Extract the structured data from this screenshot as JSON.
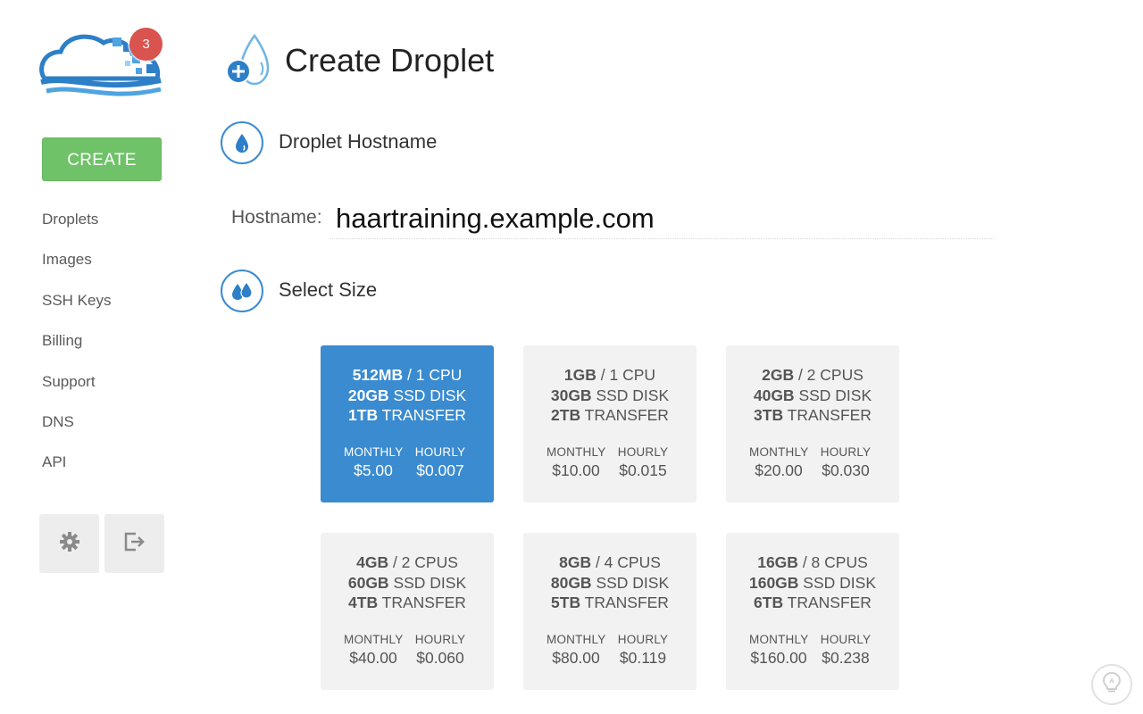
{
  "sidebar": {
    "notification_count": "3",
    "create_label": "CREATE",
    "items": [
      {
        "label": "Droplets"
      },
      {
        "label": "Images"
      },
      {
        "label": "SSH Keys"
      },
      {
        "label": "Billing"
      },
      {
        "label": "Support"
      },
      {
        "label": "DNS"
      },
      {
        "label": "API"
      }
    ],
    "settings_icon": "gear-icon",
    "logout_icon": "logout-icon"
  },
  "header": {
    "title": "Create Droplet",
    "icon": "droplet-plus-icon"
  },
  "hostname_section": {
    "title": "Droplet Hostname",
    "icon": "droplet-icon",
    "label": "Hostname:",
    "value": "haartraining.example.com"
  },
  "size_section": {
    "title": "Select Size",
    "icon": "double-droplet-icon",
    "monthly_label": "MONTHLY",
    "hourly_label": "HOURLY",
    "sizes": [
      {
        "memory": "512MB",
        "cpu": "/ 1 CPU",
        "disk": "20GB",
        "disk_label": " SSD DISK",
        "transfer": "1TB",
        "transfer_label": " TRANSFER",
        "monthly": "$5.00",
        "hourly": "$0.007",
        "selected": true
      },
      {
        "memory": "1GB",
        "cpu": "/ 1 CPU",
        "disk": "30GB",
        "disk_label": " SSD DISK",
        "transfer": "2TB",
        "transfer_label": " TRANSFER",
        "monthly": "$10.00",
        "hourly": "$0.015",
        "selected": false
      },
      {
        "memory": "2GB",
        "cpu": "/ 2 CPUS",
        "disk": "40GB",
        "disk_label": " SSD DISK",
        "transfer": "3TB",
        "transfer_label": " TRANSFER",
        "monthly": "$20.00",
        "hourly": "$0.030",
        "selected": false
      },
      {
        "memory": "4GB",
        "cpu": "/ 2 CPUS",
        "disk": "60GB",
        "disk_label": " SSD DISK",
        "transfer": "4TB",
        "transfer_label": " TRANSFER",
        "monthly": "$40.00",
        "hourly": "$0.060",
        "selected": false
      },
      {
        "memory": "8GB",
        "cpu": "/ 4 CPUS",
        "disk": "80GB",
        "disk_label": " SSD DISK",
        "transfer": "5TB",
        "transfer_label": " TRANSFER",
        "monthly": "$80.00",
        "hourly": "$0.119",
        "selected": false
      },
      {
        "memory": "16GB",
        "cpu": "/ 8 CPUS",
        "disk": "160GB",
        "disk_label": " SSD DISK",
        "transfer": "6TB",
        "transfer_label": " TRANSFER",
        "monthly": "$160.00",
        "hourly": "$0.238",
        "selected": false
      }
    ]
  },
  "help": {
    "icon": "lightbulb-icon"
  },
  "colors": {
    "accent": "#3a8bd0",
    "create_green": "#6fc268",
    "badge_red": "#d9534f"
  }
}
